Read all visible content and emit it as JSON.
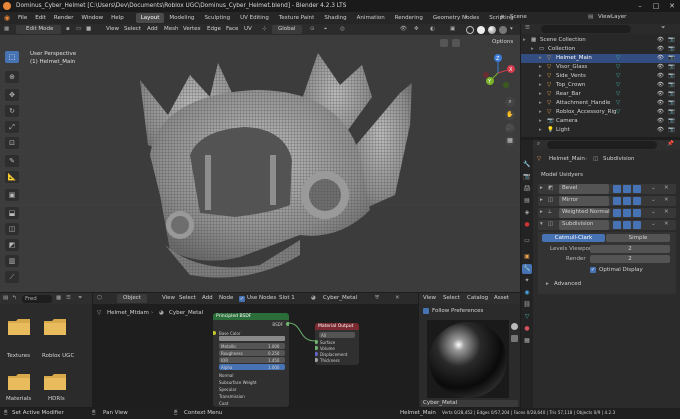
{
  "titlebar": {
    "title": "Dominus_Cyber_Helmet [C:\\Users\\Dev\\Documents\\Roblox UGC\\Dominus_Cyber_Helmet.blend] - Blender 4.2.3 LTS"
  },
  "menubar": {
    "items": [
      "File",
      "Edit",
      "Render",
      "Window",
      "Help"
    ],
    "workspaces": [
      "Layout",
      "Modeling",
      "Sculpting",
      "UV Editing",
      "Texture Paint",
      "Shading",
      "Animation",
      "Rendering",
      "Geometry Nodes",
      "Scripting"
    ],
    "active_workspace": "Layout",
    "scene_label": "Scene",
    "view_layer_label": "ViewLayer"
  },
  "viewport_header": {
    "mode": "Edit Mode",
    "menus": [
      "View",
      "Select",
      "Add",
      "Mesh",
      "Vertex",
      "Edge",
      "Face",
      "UV"
    ],
    "transform_orientation": "Global",
    "options_label": "Options"
  },
  "viewport": {
    "perspective_label": "User Perspective",
    "object_label": "(1) Helmet_Main",
    "gizmo_axes": [
      "X",
      "Y",
      "Z"
    ]
  },
  "outliner": {
    "root": "Scene Collection",
    "collection": "Collection",
    "items": [
      {
        "name": "Helmet_Main",
        "selected": true
      },
      {
        "name": "Visor_Glass",
        "selected": false
      },
      {
        "name": "Side_Vents",
        "selected": false
      },
      {
        "name": "Top_Crown",
        "selected": false
      },
      {
        "name": "Rear_Bar",
        "selected": false
      },
      {
        "name": "Attachment_Handle",
        "selected": false
      },
      {
        "name": "Roblox_Accessory_Rig",
        "selected": false
      },
      {
        "name": "Camera",
        "selected": false
      },
      {
        "name": "Light",
        "selected": false
      }
    ]
  },
  "properties": {
    "object_name": "Helmet_Main",
    "modifier_context": "Subdivision",
    "panel_title": "Model Usidyers",
    "modifiers": [
      "Bevel",
      "Mirror",
      "Weighted Normal",
      "Subdivision"
    ],
    "subdiv_modes": [
      "Catmull-Clark",
      "Simple"
    ],
    "active_subdiv_mode": "Catmull-Clark",
    "levels_viewport_label": "Levels Viewport",
    "levels_viewport_value": "2",
    "render_label": "Render",
    "render_value": "2",
    "optimal_display_label": "Optimal Display",
    "optimal_display_checked": true,
    "advanced_label": "Advanced"
  },
  "file_browser": {
    "search_placeholder": "Fred",
    "folders": [
      "Textures",
      "Roblox UGC",
      "Materials",
      "HDRIs"
    ]
  },
  "node_editor": {
    "header_mode": "Object",
    "menus": [
      "View",
      "Select",
      "Add",
      "Node"
    ],
    "use_nodes_label": "Use Nodes",
    "use_nodes_checked": true,
    "slot_label": "Slot 1",
    "material_name": "Cyber_Metal",
    "breadcrumb": [
      "Helmet_Mtdam",
      "Cyber_Metal"
    ],
    "principled_node": {
      "title": "Principled BSDF",
      "output_label": "BSDF",
      "rows": [
        "Base Color",
        "Metallic",
        "Roughness",
        "IOR",
        "Alpha",
        "Normal",
        "Subsurface Weight",
        "Specular",
        "Transmission",
        "Coat",
        "Sheen",
        "Emission"
      ],
      "metallic_value": "1.000",
      "roughness_value": "0.250",
      "ior_value": "1.450",
      "alpha_value": "1.000"
    },
    "output_node": {
      "title": "Material Output",
      "target": "All",
      "inputs": [
        "Surface",
        "Volume",
        "Displacement",
        "Thickness"
      ]
    }
  },
  "preview": {
    "menus": [
      "View",
      "Select",
      "Catalog",
      "Asset"
    ],
    "follow_label": "Follow Preferences",
    "material_label": "Cyber_Metal"
  },
  "statusbar": {
    "left_items": [
      "Set Active Modifier",
      "Pan View",
      "Context Menu"
    ],
    "object": "Helmet_Main",
    "stats": "Verts 0/28,452 | Edges 0/57,204 | Faces 0/28,640 | Tris 57,118 | Objects 0/9 | 4.2.3"
  },
  "colors": {
    "accent_blue": "#4772b3",
    "selection_blue": "#334d80",
    "object_orange": "#e8a04c",
    "mesh_teal": "#3fb3a5",
    "principled_green": "#2b6e3a",
    "output_red": "#7a2a30"
  }
}
